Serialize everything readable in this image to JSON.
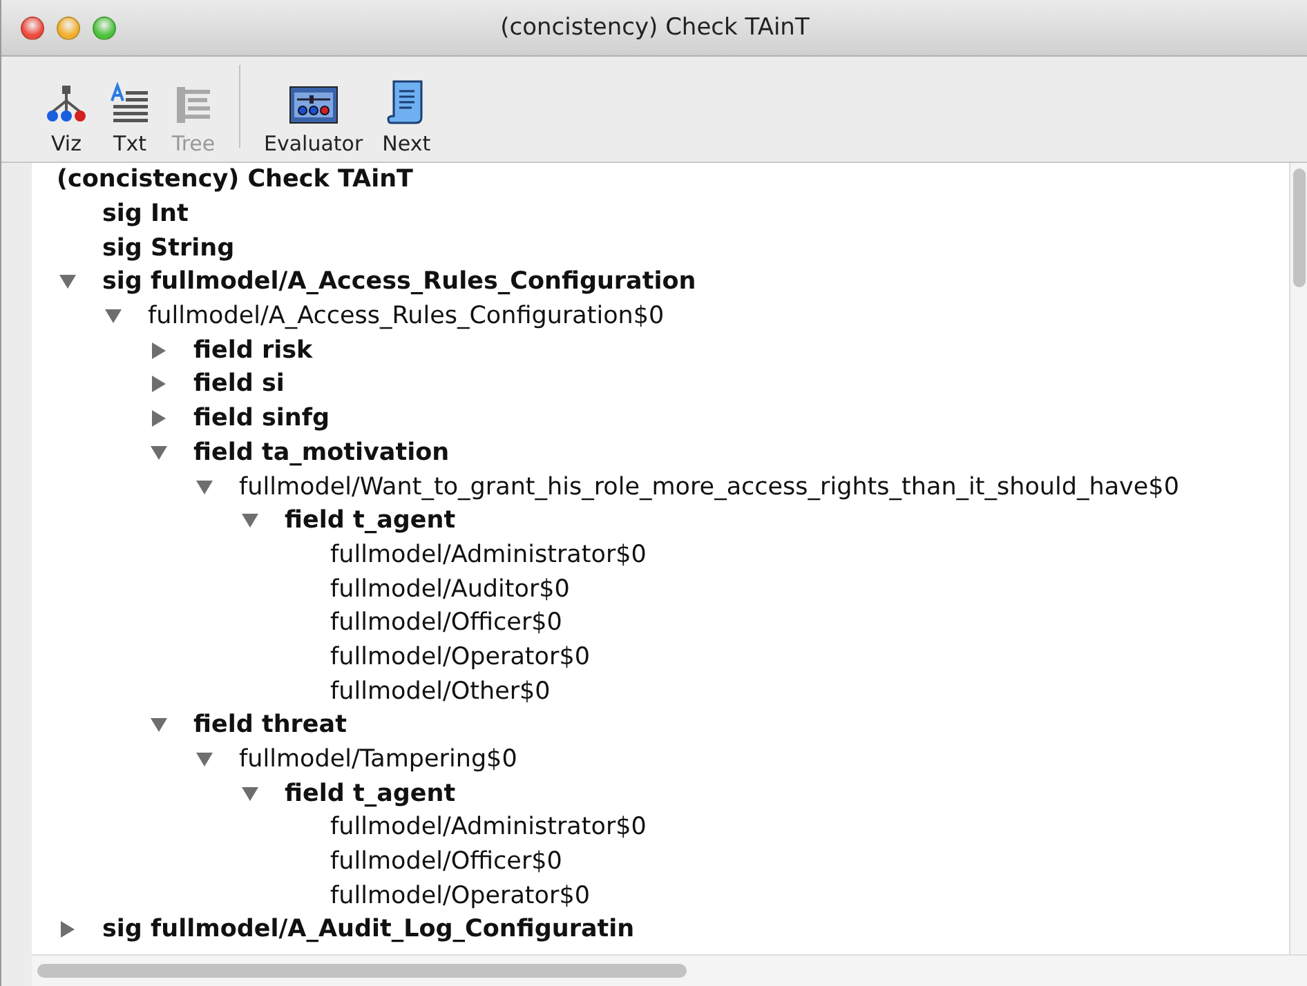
{
  "window": {
    "title": "(concistency) Check TAinT"
  },
  "toolbar": [
    {
      "kind": "viz",
      "label": "Viz",
      "disabled": false
    },
    {
      "kind": "txt",
      "label": "Txt",
      "disabled": false
    },
    {
      "kind": "tree",
      "label": "Tree",
      "disabled": true
    },
    {
      "kind": "separator"
    },
    {
      "kind": "evaluator",
      "label": "Evaluator",
      "disabled": false
    },
    {
      "kind": "next",
      "label": "Next",
      "disabled": false
    }
  ],
  "tree": {
    "label": "(concistency) Check TAinT",
    "kind": "label",
    "children": [
      {
        "label": "sig Int",
        "kind": "label"
      },
      {
        "label": "sig String",
        "kind": "label"
      },
      {
        "label": "sig fullmodel/A_Access_Rules_Configuration",
        "kind": "label",
        "expanded": true,
        "children": [
          {
            "label": "fullmodel/A_Access_Rules_Configuration$0",
            "kind": "atom",
            "expanded": true,
            "children": [
              {
                "label": "field risk",
                "kind": "label",
                "expanded": false
              },
              {
                "label": "field si",
                "kind": "label",
                "expanded": false
              },
              {
                "label": "field sinfg",
                "kind": "label",
                "expanded": false
              },
              {
                "label": "field ta_motivation",
                "kind": "label",
                "expanded": true,
                "children": [
                  {
                    "label": "fullmodel/Want_to_grant_his_role_more_access_rights_than_it_should_have$0",
                    "kind": "atom",
                    "expanded": true,
                    "children": [
                      {
                        "label": "field t_agent",
                        "kind": "label",
                        "expanded": true,
                        "children": [
                          {
                            "label": "fullmodel/Administrator$0",
                            "kind": "atom"
                          },
                          {
                            "label": "fullmodel/Auditor$0",
                            "kind": "atom"
                          },
                          {
                            "label": "fullmodel/Officer$0",
                            "kind": "atom"
                          },
                          {
                            "label": "fullmodel/Operator$0",
                            "kind": "atom"
                          },
                          {
                            "label": "fullmodel/Other$0",
                            "kind": "atom"
                          }
                        ]
                      }
                    ]
                  }
                ]
              },
              {
                "label": "field threat",
                "kind": "label",
                "expanded": true,
                "children": [
                  {
                    "label": "fullmodel/Tampering$0",
                    "kind": "atom",
                    "expanded": true,
                    "children": [
                      {
                        "label": "field t_agent",
                        "kind": "label",
                        "expanded": true,
                        "children": [
                          {
                            "label": "fullmodel/Administrator$0",
                            "kind": "atom"
                          },
                          {
                            "label": "fullmodel/Officer$0",
                            "kind": "atom"
                          },
                          {
                            "label": "fullmodel/Operator$0",
                            "kind": "atom"
                          }
                        ]
                      }
                    ]
                  }
                ]
              }
            ]
          }
        ]
      },
      {
        "label": "sig fullmodel/A_Audit_Log_Configuratin",
        "kind": "label",
        "expanded": false
      }
    ]
  }
}
